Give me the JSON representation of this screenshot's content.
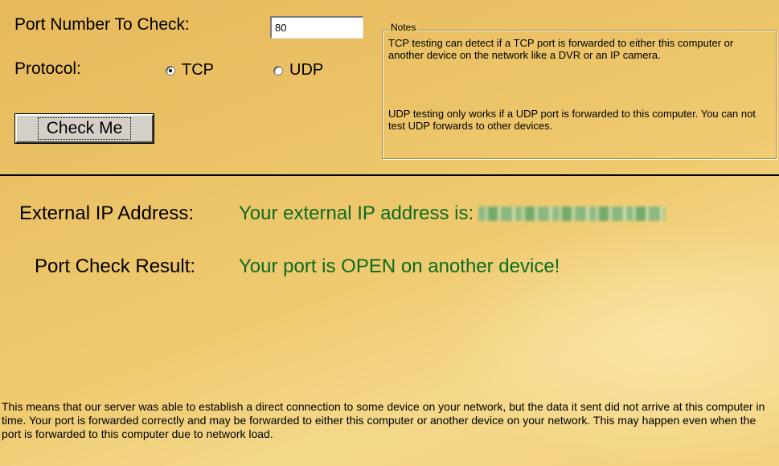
{
  "form": {
    "port_label": "Port Number To Check:",
    "port_value": "80",
    "protocol_label": "Protocol:",
    "protocol_options": [
      {
        "label": "TCP",
        "selected": true
      },
      {
        "label": "UDP",
        "selected": false
      }
    ],
    "check_button_label": "Check Me"
  },
  "notes": {
    "legend": "Notes",
    "tcp_text": "TCP testing can detect if a TCP port is forwarded to either this computer or another device on the network like a DVR or an IP camera.",
    "udp_text": "UDP testing only works if a UDP port is forwarded to this computer. You can not test UDP forwards to other devices."
  },
  "results": {
    "external_ip_label": "External IP Address:",
    "external_ip_text": "Your external IP address is:",
    "port_check_label": "Port Check Result:",
    "port_check_text": "Your port is OPEN on another device!"
  },
  "explanation": "This means that our server was able to establish a direct connection to some device on your network, but the data it sent did not arrive at this computer in time. Your port is forwarded correctly and may be forwarded to either this computer or another device on your network. This may happen even when the port is forwarded to this computer due to network load.",
  "colors": {
    "background": "#ebc266",
    "result_text": "#0a6b1f"
  }
}
